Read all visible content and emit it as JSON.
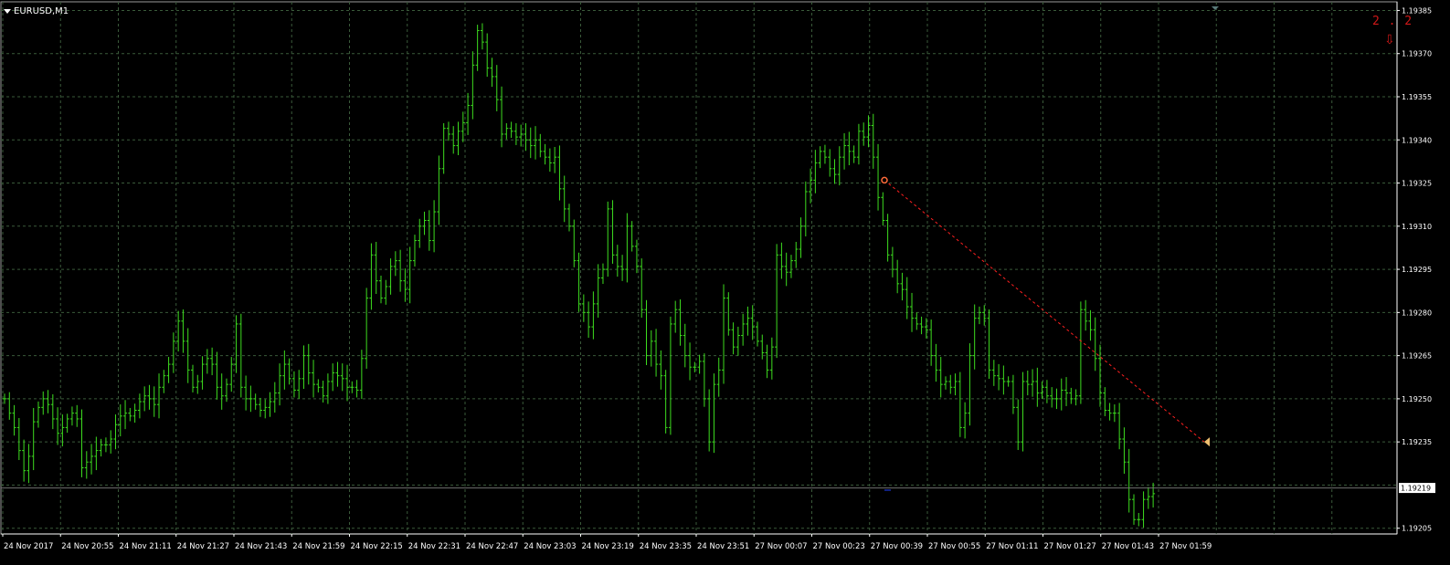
{
  "window": {
    "symbol_title": "EURUSD,M1"
  },
  "indicator": {
    "ratio_text": "2 . 2",
    "arrow_glyph": "⇩"
  },
  "colors": {
    "background": "#000000",
    "grid": "#3a5a3a",
    "bars": "#3ddc1f",
    "axis_text": "#ffffff",
    "trendline": "#ff2020",
    "bid_line": "#6f6f6f",
    "current_price_box": "#ffffff",
    "indicator_text": "#d01818"
  },
  "price_axis": {
    "labels": [
      "1.19385",
      "1.19370",
      "1.19355",
      "1.19340",
      "1.19325",
      "1.19310",
      "1.19295",
      "1.19280",
      "1.19265",
      "1.19250",
      "1.19235",
      "1.19205"
    ],
    "current_price": "1.19219"
  },
  "time_axis": {
    "labels": [
      "24 Nov 2017",
      "24 Nov 20:55",
      "24 Nov 21:11",
      "24 Nov 21:27",
      "24 Nov 21:43",
      "24 Nov 21:59",
      "24 Nov 22:15",
      "24 Nov 22:31",
      "24 Nov 22:47",
      "24 Nov 23:03",
      "24 Nov 23:19",
      "24 Nov 23:35",
      "24 Nov 23:51",
      "27 Nov 00:07",
      "27 Nov 00:23",
      "27 Nov 00:39",
      "27 Nov 00:55",
      "27 Nov 01:11",
      "27 Nov 01:27",
      "27 Nov 01:43",
      "27 Nov 01:59"
    ]
  },
  "chart_data": {
    "type": "line",
    "symbol": "EURUSD",
    "timeframe": "M1",
    "x": [
      "24 Nov 2017",
      "24 Nov 20:55",
      "24 Nov 21:11",
      "24 Nov 21:27",
      "24 Nov 21:43",
      "24 Nov 21:59",
      "24 Nov 22:15",
      "24 Nov 22:31",
      "24 Nov 22:47",
      "24 Nov 23:03",
      "24 Nov 23:19",
      "24 Nov 23:35",
      "24 Nov 23:51",
      "27 Nov 00:07",
      "27 Nov 00:23",
      "27 Nov 00:39",
      "27 Nov 00:55",
      "27 Nov 01:11",
      "27 Nov 01:27",
      "27 Nov 01:43",
      "27 Nov 01:59"
    ],
    "ylim": [
      1.19203,
      1.19388
    ],
    "grid": true,
    "close": [
      1.1925,
      1.19245,
      1.1924,
      1.19232,
      1.19225,
      1.1923,
      1.19242,
      1.19247,
      1.1925,
      1.19248,
      1.19243,
      1.19238,
      1.1924,
      1.19243,
      1.19245,
      1.19243,
      1.19226,
      1.19228,
      1.1923,
      1.19232,
      1.19234,
      1.19234,
      1.19236,
      1.19241,
      1.19244,
      1.19245,
      1.19244,
      1.19246,
      1.19249,
      1.19251,
      1.1925,
      1.19248,
      1.19254,
      1.19258,
      1.19262,
      1.1927,
      1.19277,
      1.1927,
      1.1926,
      1.19254,
      1.19256,
      1.19262,
      1.19264,
      1.19262,
      1.19254,
      1.19251,
      1.19255,
      1.19262,
      1.19276,
      1.19254,
      1.1925,
      1.1925,
      1.19248,
      1.19246,
      1.19247,
      1.19249,
      1.19252,
      1.19258,
      1.19262,
      1.19257,
      1.19253,
      1.19257,
      1.19265,
      1.19259,
      1.19255,
      1.19254,
      1.19251,
      1.19256,
      1.19259,
      1.19258,
      1.19257,
      1.19254,
      1.19254,
      1.19253,
      1.19264,
      1.19285,
      1.193,
      1.19291,
      1.19285,
      1.19289,
      1.19296,
      1.19298,
      1.19291,
      1.19288,
      1.19298,
      1.19305,
      1.1931,
      1.19312,
      1.19305,
      1.19315,
      1.1933,
      1.19344,
      1.19342,
      1.19338,
      1.19343,
      1.19346,
      1.19352,
      1.19366,
      1.19378,
      1.19374,
      1.19365,
      1.19362,
      1.19354,
      1.19342,
      1.19344,
      1.19343,
      1.19341,
      1.19342,
      1.1934,
      1.19338,
      1.1934,
      1.19336,
      1.19334,
      1.19332,
      1.19334,
      1.19323,
      1.19316,
      1.1931,
      1.19298,
      1.19283,
      1.1928,
      1.19275,
      1.19283,
      1.19292,
      1.19295,
      1.19316,
      1.193,
      1.19296,
      1.19295,
      1.1931,
      1.19303,
      1.19296,
      1.19281,
      1.19265,
      1.1927,
      1.19262,
      1.19258,
      1.1924,
      1.19276,
      1.19281,
      1.19272,
      1.19265,
      1.19261,
      1.19261,
      1.19263,
      1.1925,
      1.19235,
      1.19255,
      1.1926,
      1.19285,
      1.19274,
      1.19268,
      1.19272,
      1.19276,
      1.19278,
      1.19275,
      1.1927,
      1.19266,
      1.1926,
      1.19268,
      1.193,
      1.19296,
      1.19294,
      1.19298,
      1.19302,
      1.1931,
      1.19322,
      1.19326,
      1.19332,
      1.19336,
      1.19334,
      1.1933,
      1.19328,
      1.19334,
      1.19338,
      1.19336,
      1.19334,
      1.19343,
      1.19341,
      1.19345,
      1.19334,
      1.1932,
      1.19312,
      1.193,
      1.19295,
      1.1929,
      1.19288,
      1.19282,
      1.19278,
      1.19276,
      1.19275,
      1.19274,
      1.19265,
      1.1926,
      1.19255,
      1.19256,
      1.19254,
      1.19256,
      1.1924,
      1.19245,
      1.19265,
      1.19278,
      1.1928,
      1.19278,
      1.1926,
      1.19258,
      1.19257,
      1.19256,
      1.19256,
      1.19247,
      1.19235,
      1.19256,
      1.19255,
      1.19256,
      1.19252,
      1.19254,
      1.19251,
      1.1925,
      1.1925,
      1.19253,
      1.19252,
      1.1925,
      1.19251,
      1.19281,
      1.19277,
      1.19274,
      1.19264,
      1.19252,
      1.19246,
      1.19245,
      1.19245,
      1.19236,
      1.19228,
      1.19215,
      1.19208,
      1.19208,
      1.19215,
      1.19216,
      1.19217
    ],
    "trendline": {
      "from": {
        "x": "27 Nov 00:39",
        "y": 1.19326
      },
      "to": {
        "x": "27 Nov 01:59",
        "y": 1.19235
      },
      "style": "dashed"
    },
    "current_price": 1.19219
  }
}
